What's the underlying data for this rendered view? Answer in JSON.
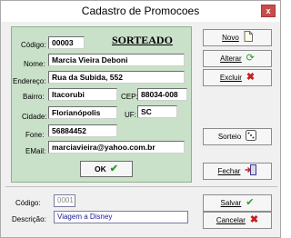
{
  "window": {
    "title": "Cadastro de Promocoes",
    "close_label": "x"
  },
  "panel": {
    "heading": "SORTEADO",
    "codigo": {
      "label": "Código:",
      "value": "00003"
    },
    "nome": {
      "label": "Nome:",
      "value": "Marcia Vieira Deboni"
    },
    "endereco": {
      "label": "Endereço:",
      "value": "Rua da Subida, 552"
    },
    "bairro": {
      "label": "Bairro:",
      "value": "Itacorubi"
    },
    "cep": {
      "label": "CEP:",
      "value": "88034-008"
    },
    "cidade": {
      "label": "Cidade:",
      "value": "Florianópolis"
    },
    "uf": {
      "label": "UF:",
      "value": "SC"
    },
    "fone": {
      "label": "Fone:",
      "value": "56884452"
    },
    "email": {
      "label": "EMail:",
      "value": "marciavieira@yahoo.com.br"
    },
    "ok_label": "OK"
  },
  "buttons": {
    "novo": "Novo",
    "alterar": "Alterar",
    "excluir": "Excluir",
    "sorteio": "Sorteio",
    "fechar": "Fechar",
    "salvar": "Salvar",
    "cancelar": "Cancelar"
  },
  "bottom": {
    "codigo": {
      "label": "Código:",
      "value": "0001"
    },
    "descricao": {
      "label": "Descrição:",
      "value": "Viagem a Disney"
    }
  },
  "colors": {
    "panel_bg": "#c9e0c9",
    "close_bg": "#c94c4c",
    "accent_green": "#2e9a2e",
    "accent_red": "#c81e1e"
  },
  "icons": [
    "new-document-icon",
    "refresh-icon",
    "delete-x-icon",
    "dice-icon",
    "exit-door-icon",
    "checkmark-icon",
    "cancel-x-icon"
  ]
}
